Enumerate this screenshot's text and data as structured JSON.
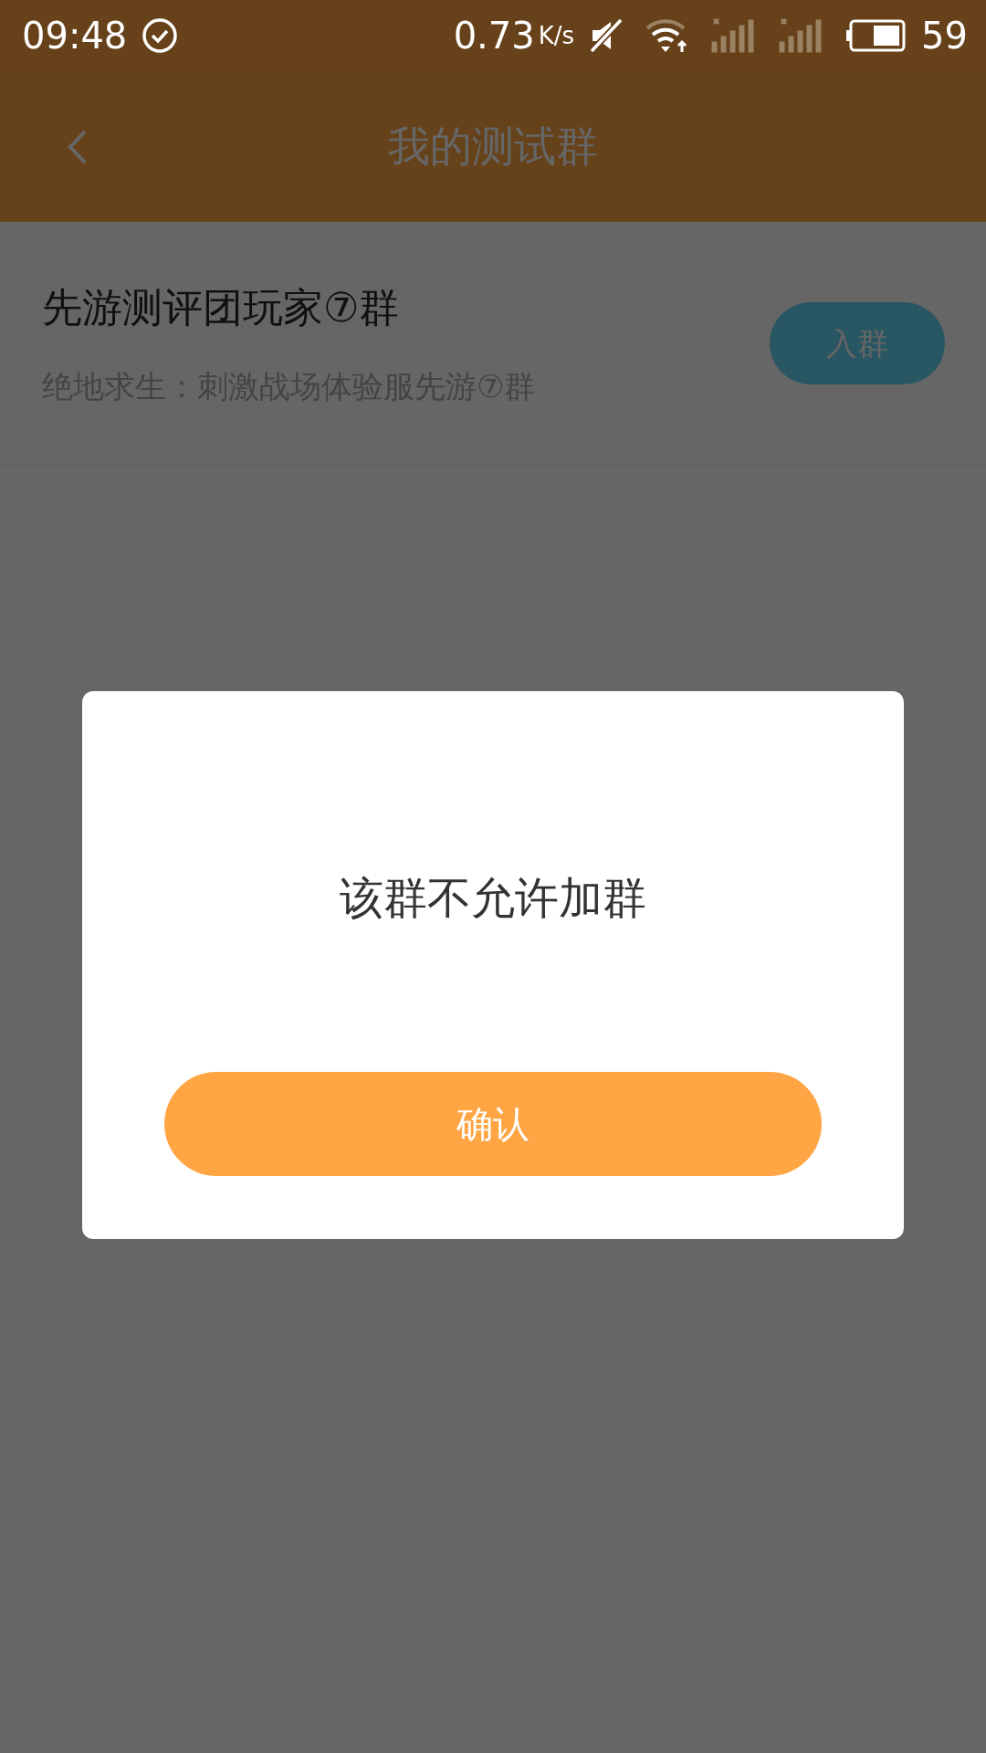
{
  "status_bar": {
    "time": "09:48",
    "speed": "0.73",
    "speed_unit": "K/s",
    "battery": "59"
  },
  "header": {
    "title": "我的测试群"
  },
  "groups": [
    {
      "name": "先游测评团玩家⑦群",
      "description": "绝地求生：刺激战场体验服先游⑦群",
      "button": "入群"
    }
  ],
  "dialog": {
    "message": "该群不允许加群",
    "button": "确认"
  }
}
